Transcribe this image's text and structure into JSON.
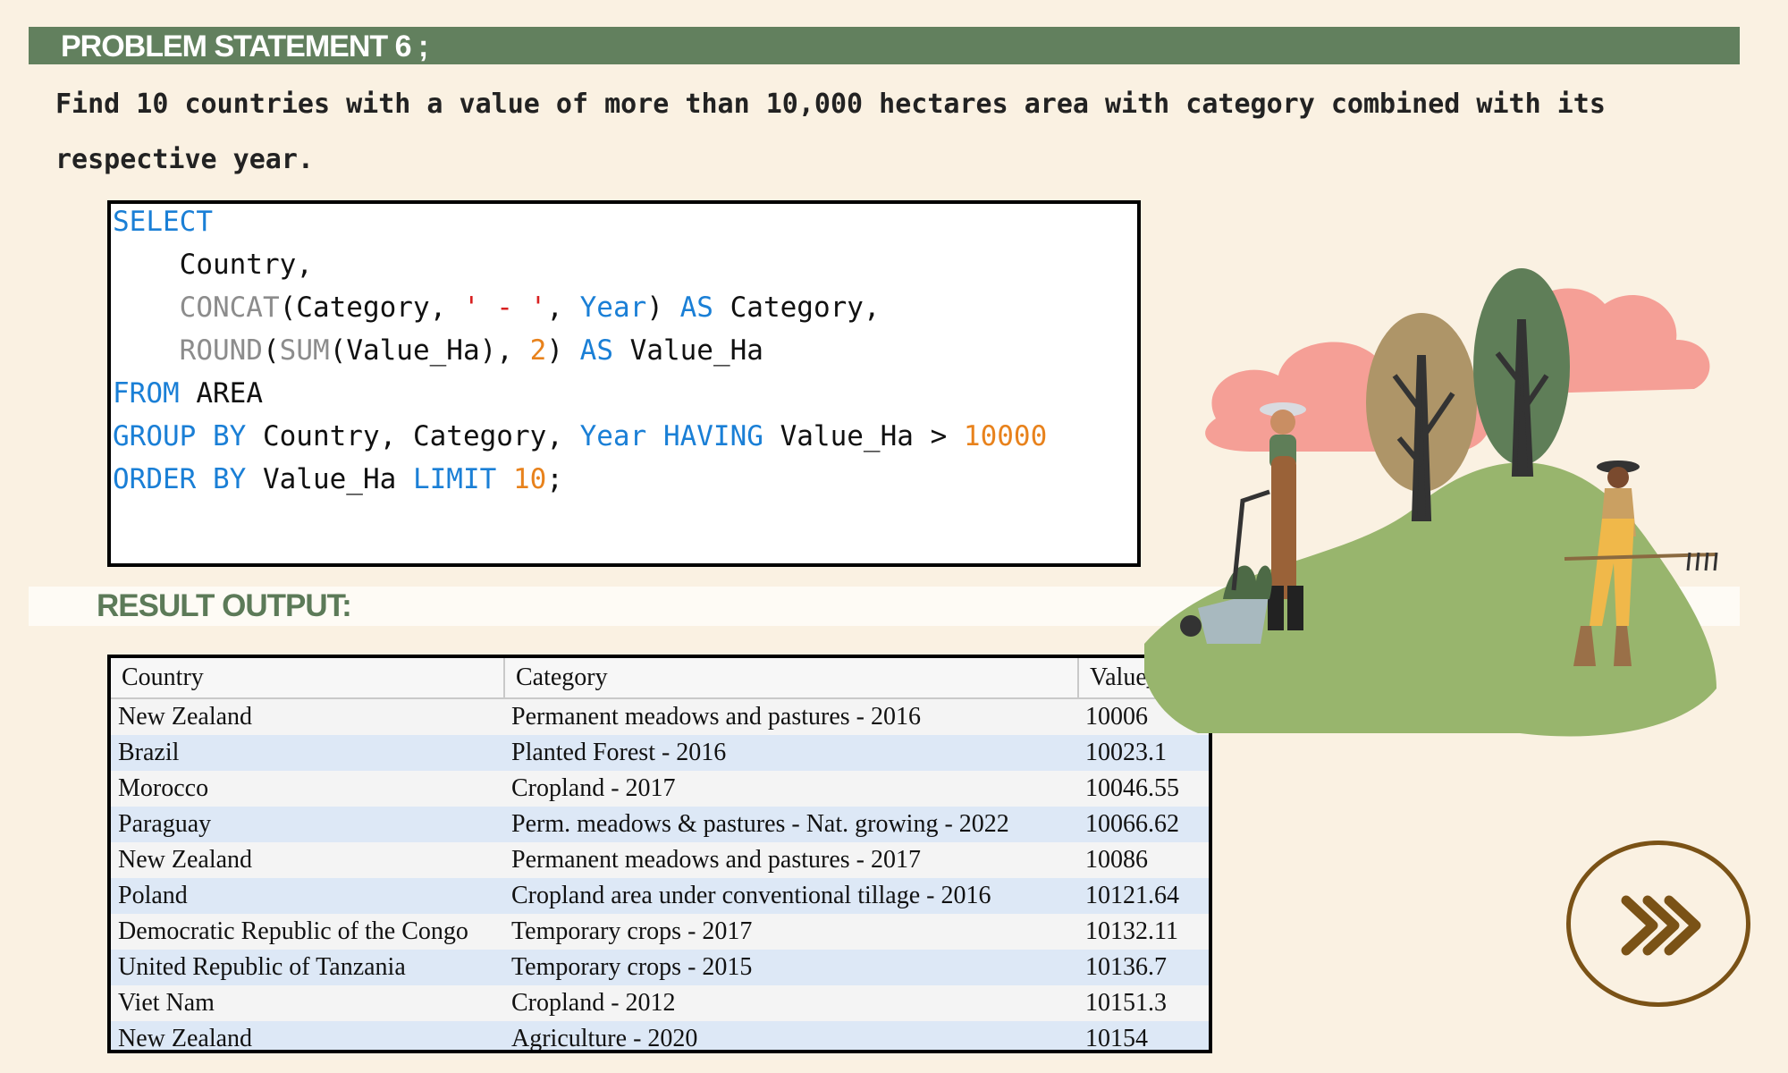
{
  "header": {
    "title": "PROBLEM STATEMENT 6 ;"
  },
  "problem": {
    "line1": "Find 10 countries with a value of more than 10,000 hectares area with category combined with its",
    "line2": "respective year."
  },
  "sql": {
    "select": "SELECT",
    "country": "Country,",
    "concat": "CONCAT",
    "paren_category": "(Category,",
    "dash_string": "' - '",
    "comma": ",",
    "year": "Year",
    "close_paren": ")",
    "as": "AS",
    "category_alias": "Category,",
    "round": "ROUND",
    "open_paren": "(",
    "sum": "SUM",
    "value_ha_arg": "(Value_Ha),",
    "two": "2",
    "value_ha": "Value_Ha",
    "from": "FROM",
    "area": "AREA",
    "group_by": "GROUP BY",
    "group_cols": "Country, Category,",
    "having": "HAVING",
    "gt": ">",
    "threshold": "10000",
    "order_by": "ORDER BY",
    "limit": "LIMIT",
    "ten": "10",
    "semicolon": ";"
  },
  "result": {
    "label": "RESULT OUTPUT:",
    "columns": [
      "Country",
      "Category",
      "Value_Ha"
    ],
    "rows": [
      [
        "New Zealand",
        "Permanent meadows and pastures - 2016",
        "10006"
      ],
      [
        "Brazil",
        "Planted Forest - 2016",
        "10023.1"
      ],
      [
        "Morocco",
        "Cropland - 2017",
        "10046.55"
      ],
      [
        "Paraguay",
        "Perm. meadows & pastures - Nat. growing - 2022",
        "10066.62"
      ],
      [
        "New Zealand",
        "Permanent meadows and pastures - 2017",
        "10086"
      ],
      [
        "Poland",
        "Cropland area under conventional tillage - 2016",
        "10121.64"
      ],
      [
        "Democratic Republic of the Congo",
        "Temporary crops - 2017",
        "10132.11"
      ],
      [
        "United Republic of Tanzania",
        "Temporary crops - 2015",
        "10136.7"
      ],
      [
        "Viet Nam",
        "Cropland - 2012",
        "10151.3"
      ],
      [
        "New Zealand",
        "Agriculture - 2020",
        "10154"
      ]
    ]
  },
  "icons": {
    "next": "chevron-triple-right-icon",
    "illustration": "farmers-illustration"
  },
  "colors": {
    "banner": "#62805e",
    "background": "#faf1e2",
    "keyword": "#1a7fd6",
    "number": "#e8821c",
    "next_button": "#7a5216"
  }
}
